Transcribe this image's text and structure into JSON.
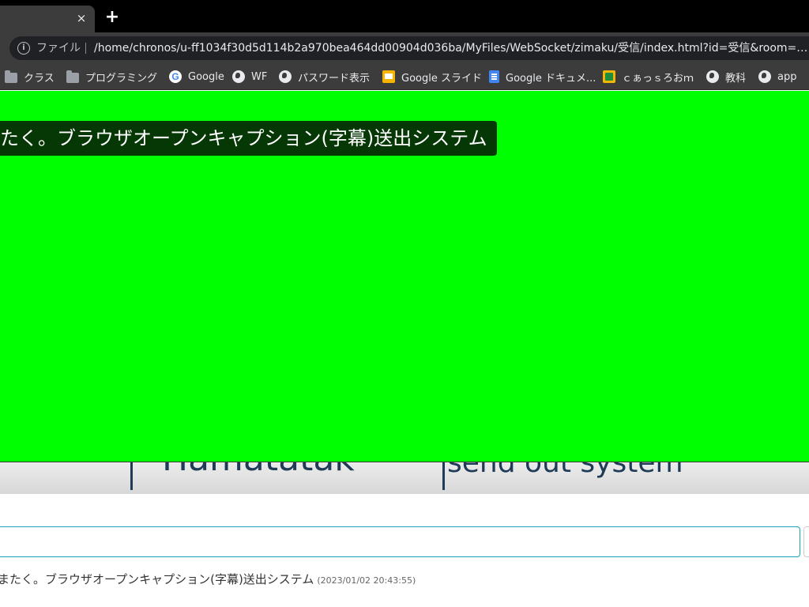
{
  "browser": {
    "tab_close": "×",
    "new_tab": "+",
    "omnibox": {
      "scheme_label": "ファイル",
      "url": "/home/chronos/u-ff1034f30d5d114b2a970bea464dd00904d036ba/MyFiles/WebSocket/zimaku/受信/index.html?id=受信&room=zimaku&pw=..."
    },
    "bookmarks": [
      {
        "label": "クラス",
        "icon": "folder-icon"
      },
      {
        "label": "プログラミング",
        "icon": "folder-icon"
      },
      {
        "label": "Google",
        "icon": "google-icon"
      },
      {
        "label": "WF",
        "icon": "globe-icon"
      },
      {
        "label": "パスワード表示",
        "icon": "globe-icon"
      },
      {
        "label": "Google スライド",
        "icon": "slides-icon"
      },
      {
        "label": "Google ドキュメ...",
        "icon": "docs-icon"
      },
      {
        "label": "ｃぁっｓろおｍ",
        "icon": "classroom-icon"
      },
      {
        "label": "教科",
        "icon": "globe-icon"
      },
      {
        "label": "app",
        "icon": "globe-icon"
      }
    ]
  },
  "overlay": {
    "caption": "たく。ブラウザオープンキャプション(字幕)送出システム",
    "color": "#00ff00"
  },
  "page": {
    "hero_logo": "Hamatatak",
    "hero_tagline": "send out system",
    "log": {
      "text": "またく。ブラウザオープンキャプション(字幕)送出システム",
      "time": "(2023/01/02 20:43:55)"
    }
  }
}
